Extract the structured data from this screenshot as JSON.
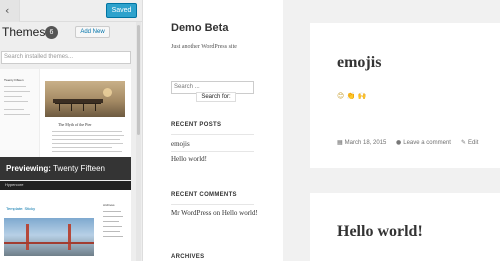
{
  "customizer": {
    "back_icon": "chevron-left-icon",
    "saved_label": "Saved",
    "themes_label": "Themes",
    "themes_count": "6",
    "add_new_label": "Add New",
    "search_placeholder": "Search installed themes...",
    "theme1": {
      "mini_site_title": "Twenty Fifteen",
      "post_title": "The Myth of the Pier"
    },
    "previewing_label": "Previewing:",
    "previewing_theme": "Twenty Fifteen",
    "theme2": {
      "site_name": "Hypercore",
      "template_title": "Template: Sticky",
      "archives_label": "Archives"
    },
    "accent_color": "#2ea2cc"
  },
  "site": {
    "title": "Demo Beta",
    "tagline": "Just another WordPress site",
    "search_placeholder": "Search ...",
    "search_tip": "Search for:",
    "recent_posts_title": "RECENT POSTS",
    "recent_posts": [
      "emojis",
      "Hello world!"
    ],
    "recent_comments_title": "RECENT COMMENTS",
    "comment_author": "Mr WordPress",
    "comment_on": "on",
    "comment_post": "Hello world!",
    "archives_title": "ARCHIVES"
  },
  "posts": [
    {
      "title": "emojis",
      "emojis": "😊 👏 🙌",
      "date": "March 18, 2015",
      "comment_link": "Leave a comment",
      "edit_link": "Edit",
      "date_icon": "calendar-icon",
      "comment_icon": "comment-icon",
      "edit_icon": "pencil-icon"
    },
    {
      "title": "Hello world!"
    }
  ]
}
